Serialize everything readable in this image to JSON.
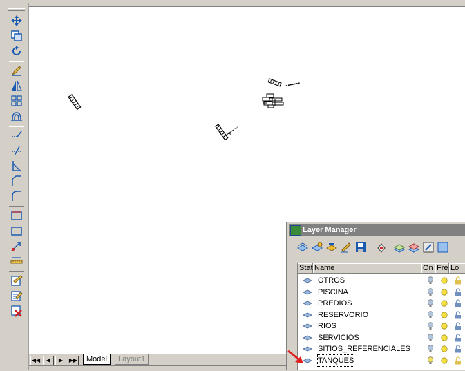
{
  "toolbar": {
    "icons": [
      "move-icon",
      "copy-icon",
      "rotate-icon",
      "pencil-icon",
      "mirror-icon",
      "array-icon",
      "offset-icon",
      "extend-icon",
      "trim-icon",
      "chamfer-corner-icon",
      "fillet-icon",
      "rounded-corner-icon",
      "rectangle-icon",
      "box-icon",
      "scale-icon",
      "measure-icon",
      "edit-hatch-icon",
      "edit-text-icon",
      "erase-icon"
    ]
  },
  "tabs": {
    "model": "Model",
    "layout": "Layout1"
  },
  "layer_manager": {
    "title": "Layer Manager",
    "columns": [
      "Stat",
      "Name",
      "On",
      "Fre",
      "Lo"
    ],
    "layers": [
      {
        "name": "OTROS",
        "on_color": "#b0c4de",
        "lock": "#e0c050"
      },
      {
        "name": "PISCINA",
        "on_color": "#b0c4de",
        "lock": "#7090c0"
      },
      {
        "name": "PREDIOS",
        "on_color": "#b0c4de",
        "lock": "#7090c0"
      },
      {
        "name": "RESERVORIO",
        "on_color": "#b0c4de",
        "lock": "#7090c0"
      },
      {
        "name": "RIOS",
        "on_color": "#b0c4de",
        "lock": "#7090c0"
      },
      {
        "name": "SERVICIOS",
        "on_color": "#b0c4de",
        "lock": "#7090c0"
      },
      {
        "name": "SITIOS_REFERENCIALES",
        "on_color": "#b0c4de",
        "lock": "#7090c0"
      },
      {
        "name": "TANQUES",
        "on_color": "#f0e060",
        "lock": "#e0c050"
      }
    ]
  },
  "colors": {
    "canvas": "#ffffff",
    "chrome": "#d4d0c8",
    "title_bar": "#808080",
    "arrow": "#e02020"
  }
}
